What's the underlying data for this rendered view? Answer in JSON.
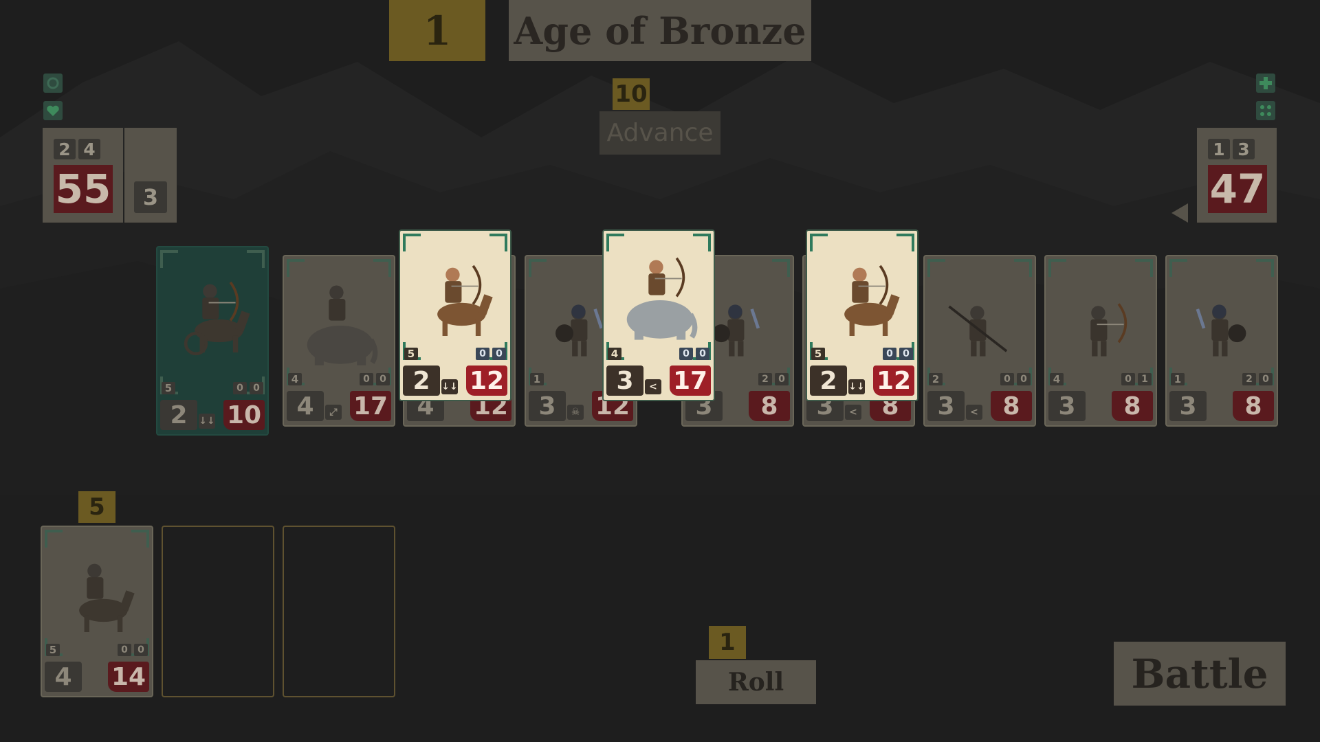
{
  "era": {
    "number": "1",
    "name": "Age of Bronze"
  },
  "advance": {
    "cost": "10",
    "label": "Advance"
  },
  "player_stats": {
    "attack": "2",
    "defense": "4",
    "hp": "55",
    "gold": "3"
  },
  "enemy_stats": {
    "attack": "1",
    "defense": "3",
    "hp": "47"
  },
  "front_cards": [
    {
      "name": "Chariot Archer",
      "tier": "5",
      "t1": "0",
      "t2": "0",
      "atk": "2",
      "hp": "10",
      "ability": "↓↓",
      "style": "team",
      "sprite": "chariot"
    },
    {
      "name": "War Elephant",
      "tier": "4",
      "t1": "0",
      "t2": "0",
      "atk": "4",
      "hp": "17",
      "ability": "⤢",
      "style": "dim",
      "sprite": "elephant"
    },
    {
      "name": "Horse Archer",
      "tier": "",
      "t1": "",
      "t2": "",
      "atk": "4",
      "hp": "12",
      "ability": "",
      "style": "dim",
      "sprite": "none"
    },
    {
      "name": "Shield Warrior",
      "tier": "1",
      "t1": "",
      "t2": "",
      "atk": "3",
      "hp": "12",
      "ability": "☠",
      "style": "dim",
      "sprite": "shield"
    },
    {
      "name": "Shield Warrior",
      "tier": "",
      "t1": "2",
      "t2": "0",
      "atk": "3",
      "hp": "8",
      "ability": "",
      "style": "dim",
      "sprite": "shield"
    },
    {
      "name": "Horse Archer",
      "tier": "",
      "t1": "",
      "t2": "",
      "atk": "3",
      "hp": "8",
      "ability": "<",
      "style": "dim",
      "sprite": "none"
    },
    {
      "name": "Spearman",
      "tier": "2",
      "t1": "0",
      "t2": "0",
      "atk": "3",
      "hp": "8",
      "ability": "<",
      "style": "dim",
      "sprite": "spear"
    },
    {
      "name": "Archer",
      "tier": "4",
      "t1": "0",
      "t2": "1",
      "atk": "3",
      "hp": "8",
      "ability": "",
      "style": "dim",
      "sprite": "archer"
    },
    {
      "name": "Swordsman",
      "tier": "1",
      "t1": "2",
      "t2": "0",
      "atk": "3",
      "hp": "8",
      "ability": "",
      "style": "dim",
      "sprite": "sword"
    }
  ],
  "shop_cards": [
    {
      "name": "Horse Archer",
      "tier": "5",
      "t1": "0",
      "t2": "0",
      "atk": "2",
      "hp": "12",
      "ability": "↓↓",
      "sprite": "horsearcher"
    },
    {
      "name": "Elephant Archer",
      "tier": "4",
      "t1": "0",
      "t2": "0",
      "atk": "3",
      "hp": "17",
      "ability": "<",
      "sprite": "elephantarcher"
    },
    {
      "name": "Horse Archer",
      "tier": "5",
      "t1": "0",
      "t2": "0",
      "atk": "2",
      "hp": "12",
      "ability": "↓↓",
      "sprite": "horsearcher2"
    }
  ],
  "reserve": {
    "cost": "5",
    "card": {
      "name": "Horse Swordsman",
      "tier": "5",
      "t1": "0",
      "t2": "0",
      "atk": "4",
      "hp": "14",
      "ability": "",
      "sprite": "horseswords"
    }
  },
  "roll": {
    "cost": "1",
    "label": "Roll"
  },
  "battle": {
    "label": "Battle"
  },
  "colors": {
    "accent_gold": "#6b5a22",
    "hp_red": "#9e1f27",
    "team_green": "#1f3f38",
    "card_cream": "#ece0c2"
  },
  "icons": {
    "left": [
      "gear-icon",
      "heart-icon"
    ],
    "right": [
      "plus-icon",
      "dice-icon"
    ]
  }
}
